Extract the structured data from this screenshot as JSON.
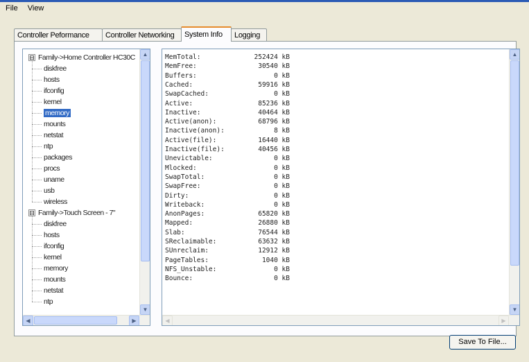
{
  "menu": {
    "file": "File",
    "view": "View"
  },
  "tabs": [
    "Controller Peformance",
    "Controller Networking",
    "System Info",
    "Logging"
  ],
  "active_tab": "System Info",
  "tree": {
    "group1": {
      "label": "Family->Home Controller HC30C",
      "items": [
        "diskfree",
        "hosts",
        "ifconfig",
        "kernel",
        "memory",
        "mounts",
        "netstat",
        "ntp",
        "packages",
        "procs",
        "uname",
        "usb",
        "wireless"
      ]
    },
    "group2": {
      "label": "Family->Touch Screen - 7\"",
      "items": [
        "diskfree",
        "hosts",
        "ifconfig",
        "kernel",
        "memory",
        "mounts",
        "netstat",
        "ntp"
      ]
    },
    "selected": "memory",
    "expander_symbol": "⊟"
  },
  "memory_info": [
    {
      "key": "MemTotal:",
      "value": "252424 kB"
    },
    {
      "key": "MemFree:",
      "value": "30540 kB"
    },
    {
      "key": "Buffers:",
      "value": "0 kB"
    },
    {
      "key": "Cached:",
      "value": "59916 kB"
    },
    {
      "key": "SwapCached:",
      "value": "0 kB"
    },
    {
      "key": "Active:",
      "value": "85236 kB"
    },
    {
      "key": "Inactive:",
      "value": "40464 kB"
    },
    {
      "key": "Active(anon):",
      "value": "68796 kB"
    },
    {
      "key": "Inactive(anon):",
      "value": "8 kB"
    },
    {
      "key": "Active(file):",
      "value": "16440 kB"
    },
    {
      "key": "Inactive(file):",
      "value": "40456 kB"
    },
    {
      "key": "Unevictable:",
      "value": "0 kB"
    },
    {
      "key": "Mlocked:",
      "value": "0 kB"
    },
    {
      "key": "SwapTotal:",
      "value": "0 kB"
    },
    {
      "key": "SwapFree:",
      "value": "0 kB"
    },
    {
      "key": "Dirty:",
      "value": "0 kB"
    },
    {
      "key": "Writeback:",
      "value": "0 kB"
    },
    {
      "key": "AnonPages:",
      "value": "65820 kB"
    },
    {
      "key": "Mapped:",
      "value": "26880 kB"
    },
    {
      "key": "Slab:",
      "value": "76544 kB"
    },
    {
      "key": "SReclaimable:",
      "value": "63632 kB"
    },
    {
      "key": "SUnreclaim:",
      "value": "12912 kB"
    },
    {
      "key": "PageTables:",
      "value": "1040 kB"
    },
    {
      "key": "NFS_Unstable:",
      "value": "0 kB"
    },
    {
      "key": "Bounce:",
      "value": "0 kB"
    }
  ],
  "scroll": {
    "up": "▲",
    "down": "▼",
    "left": "◀",
    "right": "▶"
  },
  "save_button": "Save To File...",
  "colors": {
    "selection": "#316ac5",
    "active_tab_accent": "#e68b2c",
    "scroll_thumb": "#c9d8fb"
  }
}
